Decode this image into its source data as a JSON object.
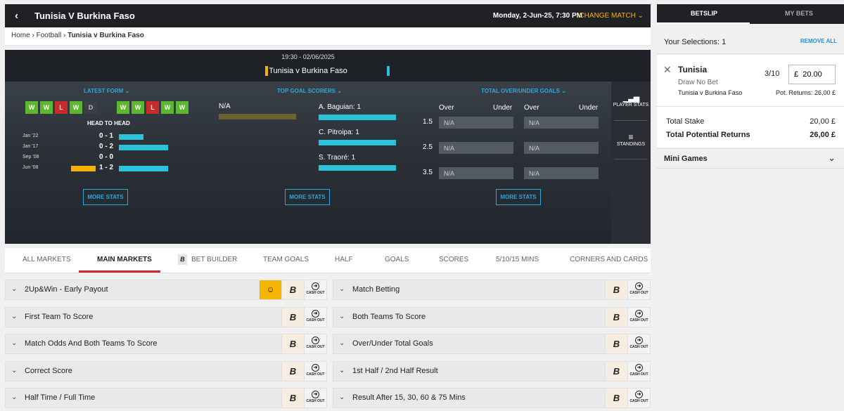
{
  "header": {
    "back": "‹",
    "title": "Tunisia V Burkina Faso",
    "date": "Monday, 2-Jun-25, 7:30 PM",
    "change_match": "CHANGE MATCH",
    "change_chevron": "⌄"
  },
  "breadcrumb": {
    "home": "Home",
    "sep1": "›",
    "football": "Football",
    "sep2": "›",
    "current": "Tunisia v Burkina Faso"
  },
  "match": {
    "kickoff": "19:30 - 02/06/2025",
    "teams": "Tunisia  v  Burkina Faso",
    "home_color": "#f5b400",
    "away_color": "#2bc3d9"
  },
  "latest_form": {
    "heading": "LATEST FORM ⌄",
    "home": [
      "W",
      "W",
      "L",
      "W",
      "D"
    ],
    "away": [
      "W",
      "W",
      "L",
      "W",
      "W"
    ],
    "h2h_title": "HEAD TO HEAD",
    "h2h": [
      {
        "date": "Jan '22",
        "score": "0 - 1",
        "home_bar": 0,
        "away_bar": 0.35
      },
      {
        "date": "Jan '17",
        "score": "0 - 2",
        "home_bar": 0,
        "away_bar": 0.7
      },
      {
        "date": "Sep '08",
        "score": "0 - 0",
        "home_bar": 0,
        "away_bar": 0
      },
      {
        "date": "Jun '08",
        "score": "1 - 2",
        "home_bar": 0.35,
        "away_bar": 0.7
      }
    ],
    "more": "MORE STATS"
  },
  "top_scorers": {
    "heading": "TOP GOAL SCORERS ⌄",
    "home_na": "N/A",
    "away": [
      {
        "name": "A. Baguian: 1",
        "bar": 1
      },
      {
        "name": "C. Pitroipa: 1",
        "bar": 1
      },
      {
        "name": "S. Traoré: 1",
        "bar": 1
      }
    ],
    "more": "MORE STATS"
  },
  "over_under": {
    "heading": "TOTAL OVER/UNDER GOALS ⌄",
    "cols": [
      "Over",
      "Under",
      "Over",
      "Under"
    ],
    "rows": [
      {
        "line": "1.5",
        "home": "N/A",
        "away": "N/A"
      },
      {
        "line": "2.5",
        "home": "N/A",
        "away": "N/A"
      },
      {
        "line": "3.5",
        "home": "N/A",
        "away": "N/A"
      }
    ],
    "more": "MORE STATS"
  },
  "side": {
    "player_stats": "PLAYER STATS",
    "standings": "STANDINGS",
    "player_icon": "bar-chart-icon",
    "standings_icon": "menu-icon"
  },
  "tabs": [
    "ALL MARKETS",
    "MAIN MARKETS",
    "BET BUILDER",
    "TEAM GOALS",
    "HALF",
    "GOALS",
    "SCORES",
    "5/10/15 MINS",
    "CORNERS AND CARDS"
  ],
  "markets_left": [
    "2Up&Win - Early Payout",
    "First Team To Score",
    "Match Odds And Both Teams To Score",
    "Correct Score",
    "Half Time / Full Time"
  ],
  "markets_right": [
    "Match Betting",
    "Both Teams To Score",
    "Over/Under Total Goals",
    "1st Half / 2nd Half Result",
    "Result After 15, 30, 60 & 75 Mins"
  ],
  "icons": {
    "bet_builder": "B",
    "cash_out": "CASH OUT",
    "cash_out_arrow": "➜",
    "chevron": "⌄",
    "early_payout": "☺"
  },
  "betslip": {
    "tab_betslip": "BETSLIP",
    "tab_mybets": "MY BETS",
    "selections": "Your Selections: 1",
    "remove_all": "REMOVE ALL",
    "close": "✕",
    "team": "Tunisia",
    "market": "Draw No Bet",
    "event": "Tunisia v Burkina Faso",
    "odds": "3/10",
    "stake": "£  20.00",
    "pot_returns": "Pot. Returns: 26,00 £",
    "total_stake_label": "Total Stake",
    "total_stake": "20,00 £",
    "total_returns_label": "Total Potential Returns",
    "total_returns": "26,00 £",
    "mini_games": "Mini Games",
    "mini_chevron": "⌄"
  }
}
